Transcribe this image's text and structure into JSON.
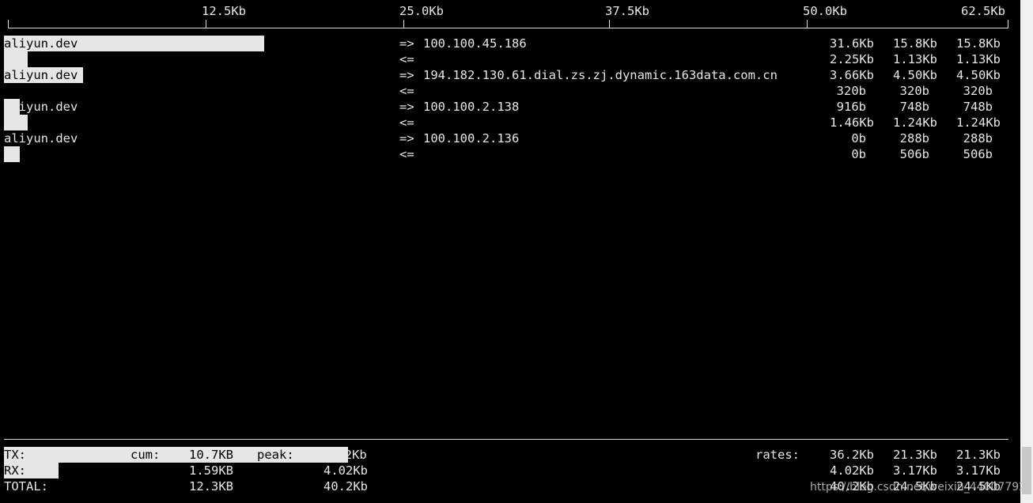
{
  "scale": {
    "labels": [
      "12.5Kb",
      "25.0Kb",
      "37.5Kb",
      "50.0Kb",
      "62.5Kb"
    ]
  },
  "connections": [
    {
      "host": "aliyun.dev",
      "peer": "100.100.45.186",
      "out_arrow": "=>",
      "in_arrow": "<=",
      "out_rates": [
        "31.6Kb",
        "15.8Kb",
        "15.8Kb"
      ],
      "in_rates": [
        "2.25Kb",
        "1.13Kb",
        "1.13Kb"
      ],
      "out_fraction": 0.2632,
      "in_fraction": 0.024
    },
    {
      "host": "aliyun.dev",
      "peer": "194.182.130.61.dial.zs.zj.dynamic.163data.com.cn",
      "out_arrow": "=>",
      "in_arrow": "<=",
      "out_rates": [
        "3.66Kb",
        "4.50Kb",
        "4.50Kb"
      ],
      "in_rates": [
        "320b",
        "320b",
        "320b"
      ],
      "out_fraction": 0.08,
      "in_fraction": 0
    },
    {
      "host": "aliyun.dev",
      "peer": "100.100.2.138",
      "out_arrow": "=>",
      "in_arrow": "<=",
      "out_rates": [
        "916b",
        "748b",
        "748b"
      ],
      "in_rates": [
        "1.46Kb",
        "1.24Kb",
        "1.24Kb"
      ],
      "out_fraction": 0.016,
      "in_fraction": 0.024
    },
    {
      "host": "aliyun.dev",
      "peer": "100.100.2.136",
      "out_arrow": "=>",
      "in_arrow": "<=",
      "out_rates": [
        "0b",
        "288b",
        "288b"
      ],
      "in_rates": [
        "0b",
        "506b",
        "506b"
      ],
      "out_fraction": 0,
      "in_fraction": 0.016
    }
  ],
  "totals": {
    "tx_label": "TX:",
    "rx_label": "RX:",
    "total_label": "TOTAL:",
    "cum_label": "cum:",
    "peak_label": "peak:",
    "rates_label": "rates:",
    "tx_cum": "10.7KB",
    "rx_cum": "1.59KB",
    "total_cum": "12.3KB",
    "tx_peak_num": "36.2",
    "tx_peak_unit": "Kb",
    "rx_peak": "4.02Kb",
    "total_peak": "40.2Kb",
    "tx_rates": [
      "36.2Kb",
      "21.3Kb",
      "21.3Kb"
    ],
    "rx_rates": [
      "4.02Kb",
      "3.17Kb",
      "3.17Kb"
    ],
    "total_rates": [
      "40.2Kb",
      "24.5Kb",
      "24.5Kb"
    ],
    "tx_fraction": 0.3482,
    "rx_fraction": 0.0554
  },
  "watermark": "https://blog.csdn.net/weixin_44007792",
  "colors": {
    "background": "#000000",
    "text": "#e6e6e6",
    "bar": "#e6e6e6"
  }
}
